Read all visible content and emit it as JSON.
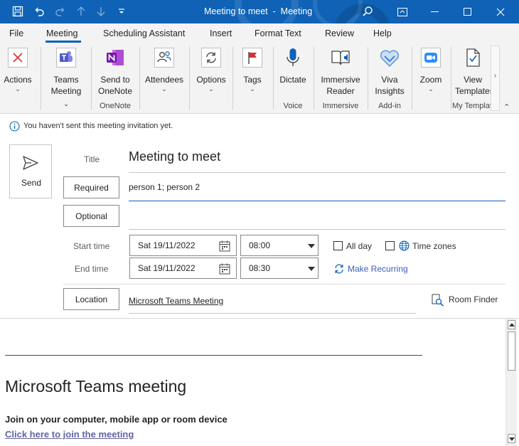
{
  "window": {
    "title": "Meeting to meet  -  Meeting",
    "accent": "#0f62b6"
  },
  "menu": {
    "items": [
      "File",
      "Meeting",
      "Scheduling Assistant",
      "Insert",
      "Format Text",
      "Review",
      "Help"
    ],
    "active": "Meeting"
  },
  "ribbon": {
    "actions": "Actions",
    "teams_1": "Teams",
    "teams_2": "Meeting",
    "onenote_1": "Send to",
    "onenote_2": "OneNote",
    "onenote_group": "OneNote",
    "attendees": "Attendees",
    "options": "Options",
    "tags": "Tags",
    "dictate": "Dictate",
    "voice_group": "Voice",
    "immersive_1": "Immersive",
    "immersive_2": "Reader",
    "immersive_group": "Immersive",
    "viva_1": "Viva",
    "viva_2": "Insights",
    "addin_group": "Add-in",
    "zoom": "Zoom",
    "view_1": "View",
    "view_2": "Templates",
    "templates_group": "My Templates"
  },
  "infobar": {
    "message": "You haven't sent this meeting invitation yet."
  },
  "form": {
    "send_label": "Send",
    "title_label": "Title",
    "title_value": "Meeting to meet",
    "required_label": "Required",
    "required_value": "person 1; person 2",
    "optional_label": "Optional",
    "optional_value": "",
    "start_label": "Start time",
    "start_date": "Sat 19/11/2022",
    "start_time": "08:00",
    "end_label": "End time",
    "end_date": "Sat 19/11/2022",
    "end_time": "08:30",
    "all_day_label": "All day",
    "all_day_checked": false,
    "time_zones_label": "Time zones",
    "time_zones_checked": false,
    "make_recurring": "Make Recurring",
    "location_label": "Location",
    "location_value": "Microsoft Teams Meeting",
    "room_finder": "Room Finder"
  },
  "body": {
    "heading": "Microsoft Teams meeting",
    "join_text": "Join on your computer, mobile app or room device",
    "join_link": "Click here to join the meeting"
  }
}
